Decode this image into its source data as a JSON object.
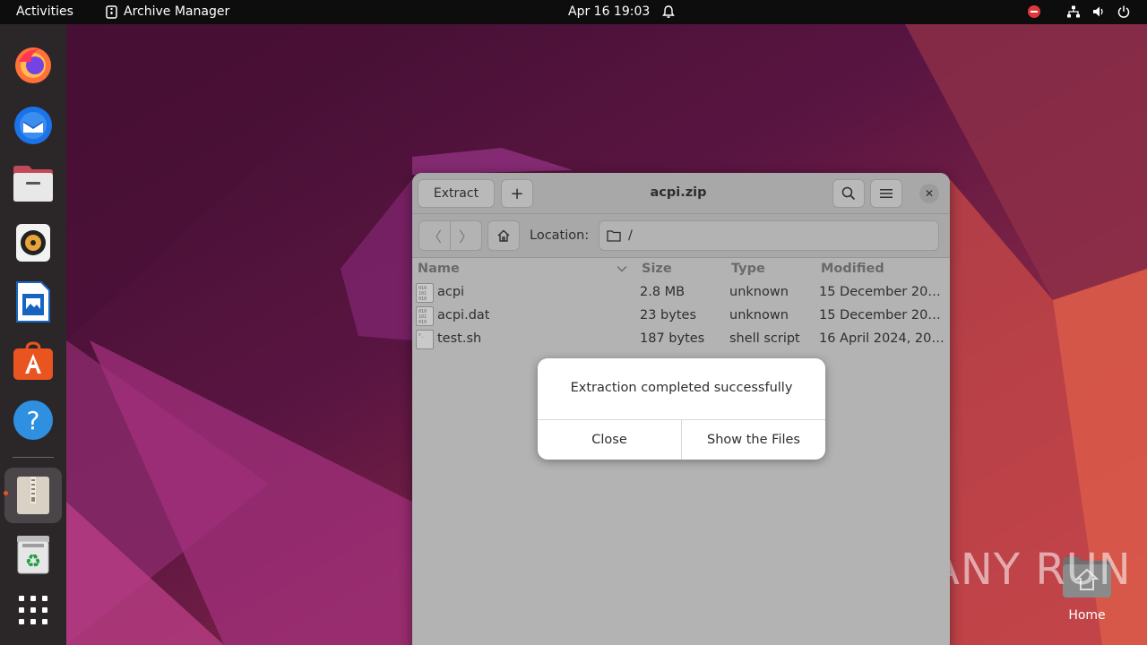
{
  "topbar": {
    "activities": "Activities",
    "app_name": "Archive Manager",
    "clock": "Apr 16  19:03"
  },
  "window": {
    "title": "acpi.zip",
    "extract_label": "Extract",
    "add_label": "+",
    "location_label": "Location:",
    "location_value": "/",
    "columns": [
      "Name",
      "Size",
      "Type",
      "Modified"
    ],
    "files": [
      {
        "name": "acpi",
        "size": "2.8 MB",
        "type": "unknown",
        "modified": "15 December 20…"
      },
      {
        "name": "acpi.dat",
        "size": "23 bytes",
        "type": "unknown",
        "modified": "15 December 20…"
      },
      {
        "name": "test.sh",
        "size": "187 bytes",
        "type": "shell script",
        "modified": "16 April 2024, 20…"
      }
    ]
  },
  "dialog": {
    "message": "Extraction completed successfully",
    "close_label": "Close",
    "show_label": "Show the Files"
  },
  "desktop": {
    "home_label": "Home",
    "watermark": "ANY RUN"
  },
  "dock": {
    "items": [
      "firefox-icon",
      "thunderbird-icon",
      "files-icon",
      "rhythmbox-icon",
      "writer-icon",
      "app-center-icon",
      "help-icon",
      "archive-manager-icon",
      "trash-icon",
      "show-apps-icon"
    ]
  },
  "colors": {
    "accent": "#e95420",
    "topbar": "#0d0d0d",
    "dock": "#2b2729",
    "window_dimmed": "#b3b3b3"
  }
}
